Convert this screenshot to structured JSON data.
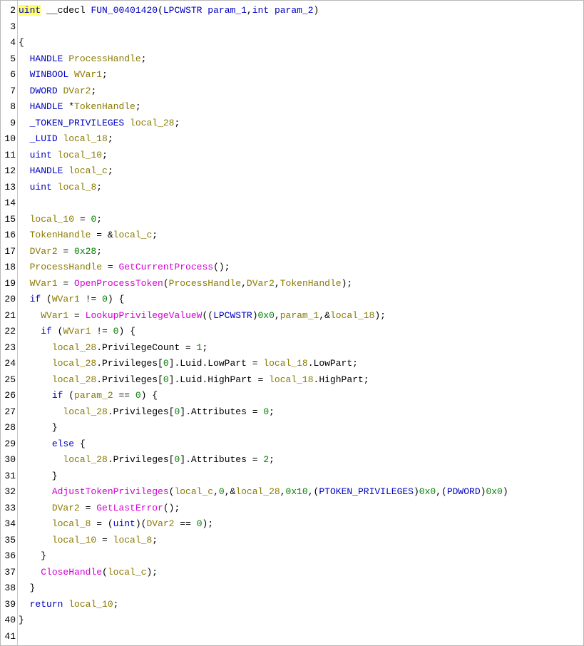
{
  "editor": {
    "colors": {
      "keyword": "#0000c0",
      "type": "#0000c0",
      "variable": "#8a7a00",
      "call": "#d400d4",
      "number": "#008000",
      "plain": "#000000",
      "highlight": "#ffff66"
    },
    "lines": [
      {
        "n": "2",
        "tokens": [
          [
            "uint",
            "ty hl"
          ],
          [
            " __cdecl ",
            ""
          ],
          [
            "FUN_00401420",
            "fn"
          ],
          [
            "(",
            ""
          ],
          [
            "LPCWSTR",
            "ty"
          ],
          [
            " ",
            ""
          ],
          [
            "param_1",
            "fn"
          ],
          [
            ",",
            ""
          ],
          [
            "int",
            "ty"
          ],
          [
            " ",
            ""
          ],
          [
            "param_2",
            "fn"
          ],
          [
            ")",
            ""
          ]
        ]
      },
      {
        "n": "3",
        "tokens": []
      },
      {
        "n": "4",
        "tokens": [
          [
            "{",
            ""
          ]
        ]
      },
      {
        "n": "5",
        "tokens": [
          [
            "  ",
            ""
          ],
          [
            "HANDLE",
            "ty"
          ],
          [
            " ",
            ""
          ],
          [
            "ProcessHandle",
            "va"
          ],
          [
            ";",
            ""
          ]
        ]
      },
      {
        "n": "6",
        "tokens": [
          [
            "  ",
            ""
          ],
          [
            "WINBOOL",
            "ty"
          ],
          [
            " ",
            ""
          ],
          [
            "WVar1",
            "va"
          ],
          [
            ";",
            ""
          ]
        ]
      },
      {
        "n": "7",
        "tokens": [
          [
            "  ",
            ""
          ],
          [
            "DWORD",
            "ty"
          ],
          [
            " ",
            ""
          ],
          [
            "DVar2",
            "va"
          ],
          [
            ";",
            ""
          ]
        ]
      },
      {
        "n": "8",
        "tokens": [
          [
            "  ",
            ""
          ],
          [
            "HANDLE",
            "ty"
          ],
          [
            " *",
            ""
          ],
          [
            "TokenHandle",
            "va"
          ],
          [
            ";",
            ""
          ]
        ]
      },
      {
        "n": "9",
        "tokens": [
          [
            "  ",
            ""
          ],
          [
            "_TOKEN_PRIVILEGES",
            "ty"
          ],
          [
            " ",
            ""
          ],
          [
            "local_28",
            "va"
          ],
          [
            ";",
            ""
          ]
        ]
      },
      {
        "n": "10",
        "tokens": [
          [
            "  ",
            ""
          ],
          [
            "_LUID",
            "ty"
          ],
          [
            " ",
            ""
          ],
          [
            "local_18",
            "va"
          ],
          [
            ";",
            ""
          ]
        ]
      },
      {
        "n": "11",
        "tokens": [
          [
            "  ",
            ""
          ],
          [
            "uint",
            "ty"
          ],
          [
            " ",
            ""
          ],
          [
            "local_10",
            "va"
          ],
          [
            ";",
            ""
          ]
        ]
      },
      {
        "n": "12",
        "tokens": [
          [
            "  ",
            ""
          ],
          [
            "HANDLE",
            "ty"
          ],
          [
            " ",
            ""
          ],
          [
            "local_c",
            "va"
          ],
          [
            ";",
            ""
          ]
        ]
      },
      {
        "n": "13",
        "tokens": [
          [
            "  ",
            ""
          ],
          [
            "uint",
            "ty"
          ],
          [
            " ",
            ""
          ],
          [
            "local_8",
            "va"
          ],
          [
            ";",
            ""
          ]
        ]
      },
      {
        "n": "14",
        "tokens": []
      },
      {
        "n": "15",
        "tokens": [
          [
            "  ",
            ""
          ],
          [
            "local_10",
            "va"
          ],
          [
            " = ",
            ""
          ],
          [
            "0",
            "nu"
          ],
          [
            ";",
            ""
          ]
        ]
      },
      {
        "n": "16",
        "tokens": [
          [
            "  ",
            ""
          ],
          [
            "TokenHandle",
            "va"
          ],
          [
            " = &",
            ""
          ],
          [
            "local_c",
            "va"
          ],
          [
            ";",
            ""
          ]
        ]
      },
      {
        "n": "17",
        "tokens": [
          [
            "  ",
            ""
          ],
          [
            "DVar2",
            "va"
          ],
          [
            " = ",
            ""
          ],
          [
            "0x28",
            "nu"
          ],
          [
            ";",
            ""
          ]
        ]
      },
      {
        "n": "18",
        "tokens": [
          [
            "  ",
            ""
          ],
          [
            "ProcessHandle",
            "va"
          ],
          [
            " = ",
            ""
          ],
          [
            "GetCurrentProcess",
            "cl"
          ],
          [
            "();",
            ""
          ]
        ]
      },
      {
        "n": "19",
        "tokens": [
          [
            "  ",
            ""
          ],
          [
            "WVar1",
            "va"
          ],
          [
            " = ",
            ""
          ],
          [
            "OpenProcessToken",
            "cl"
          ],
          [
            "(",
            ""
          ],
          [
            "ProcessHandle",
            "va"
          ],
          [
            ",",
            ""
          ],
          [
            "DVar2",
            "va"
          ],
          [
            ",",
            ""
          ],
          [
            "TokenHandle",
            "va"
          ],
          [
            ");",
            ""
          ]
        ]
      },
      {
        "n": "20",
        "tokens": [
          [
            "  ",
            ""
          ],
          [
            "if",
            "kw"
          ],
          [
            " (",
            ""
          ],
          [
            "WVar1",
            "va"
          ],
          [
            " != ",
            ""
          ],
          [
            "0",
            "nu"
          ],
          [
            ") {",
            ""
          ]
        ]
      },
      {
        "n": "21",
        "tokens": [
          [
            "    ",
            ""
          ],
          [
            "WVar1",
            "va"
          ],
          [
            " = ",
            ""
          ],
          [
            "LookupPrivilegeValueW",
            "cl"
          ],
          [
            "((",
            ""
          ],
          [
            "LPCWSTR",
            "ty"
          ],
          [
            ")",
            ""
          ],
          [
            "0x0",
            "nu"
          ],
          [
            ",",
            ""
          ],
          [
            "param_1",
            "va"
          ],
          [
            ",&",
            ""
          ],
          [
            "local_18",
            "va"
          ],
          [
            ");",
            ""
          ]
        ]
      },
      {
        "n": "22",
        "tokens": [
          [
            "    ",
            ""
          ],
          [
            "if",
            "kw"
          ],
          [
            " (",
            ""
          ],
          [
            "WVar1",
            "va"
          ],
          [
            " != ",
            ""
          ],
          [
            "0",
            "nu"
          ],
          [
            ") {",
            ""
          ]
        ]
      },
      {
        "n": "23",
        "tokens": [
          [
            "      ",
            ""
          ],
          [
            "local_28",
            "va"
          ],
          [
            ".PrivilegeCount = ",
            ""
          ],
          [
            "1",
            "nu"
          ],
          [
            ";",
            ""
          ]
        ]
      },
      {
        "n": "24",
        "tokens": [
          [
            "      ",
            ""
          ],
          [
            "local_28",
            "va"
          ],
          [
            ".Privileges[",
            ""
          ],
          [
            "0",
            "nu"
          ],
          [
            "].Luid.LowPart = ",
            ""
          ],
          [
            "local_18",
            "va"
          ],
          [
            ".LowPart;",
            ""
          ]
        ]
      },
      {
        "n": "25",
        "tokens": [
          [
            "      ",
            ""
          ],
          [
            "local_28",
            "va"
          ],
          [
            ".Privileges[",
            ""
          ],
          [
            "0",
            "nu"
          ],
          [
            "].Luid.HighPart = ",
            ""
          ],
          [
            "local_18",
            "va"
          ],
          [
            ".HighPart;",
            ""
          ]
        ]
      },
      {
        "n": "26",
        "tokens": [
          [
            "      ",
            ""
          ],
          [
            "if",
            "kw"
          ],
          [
            " (",
            ""
          ],
          [
            "param_2",
            "va"
          ],
          [
            " == ",
            ""
          ],
          [
            "0",
            "nu"
          ],
          [
            ") {",
            ""
          ]
        ]
      },
      {
        "n": "27",
        "tokens": [
          [
            "        ",
            ""
          ],
          [
            "local_28",
            "va"
          ],
          [
            ".Privileges[",
            ""
          ],
          [
            "0",
            "nu"
          ],
          [
            "].Attributes = ",
            ""
          ],
          [
            "0",
            "nu"
          ],
          [
            ";",
            ""
          ]
        ]
      },
      {
        "n": "28",
        "tokens": [
          [
            "      }",
            ""
          ]
        ]
      },
      {
        "n": "29",
        "tokens": [
          [
            "      ",
            ""
          ],
          [
            "else",
            "kw"
          ],
          [
            " {",
            ""
          ]
        ]
      },
      {
        "n": "30",
        "tokens": [
          [
            "        ",
            ""
          ],
          [
            "local_28",
            "va"
          ],
          [
            ".Privileges[",
            ""
          ],
          [
            "0",
            "nu"
          ],
          [
            "].Attributes = ",
            ""
          ],
          [
            "2",
            "nu"
          ],
          [
            ";",
            ""
          ]
        ]
      },
      {
        "n": "31",
        "tokens": [
          [
            "      }",
            ""
          ]
        ]
      },
      {
        "n": "32",
        "tokens": [
          [
            "      ",
            ""
          ],
          [
            "AdjustTokenPrivileges",
            "cl"
          ],
          [
            "(",
            ""
          ],
          [
            "local_c",
            "va"
          ],
          [
            ",",
            ""
          ],
          [
            "0",
            "nu"
          ],
          [
            ",&",
            ""
          ],
          [
            "local_28",
            "va"
          ],
          [
            ",",
            ""
          ],
          [
            "0x10",
            "nu"
          ],
          [
            ",(",
            ""
          ],
          [
            "PTOKEN_PRIVILEGES",
            "ty"
          ],
          [
            ")",
            ""
          ],
          [
            "0x0",
            "nu"
          ],
          [
            ",(",
            ""
          ],
          [
            "PDWORD",
            "ty"
          ],
          [
            ")",
            ""
          ],
          [
            "0x0",
            "nu"
          ],
          [
            ")",
            ""
          ]
        ]
      },
      {
        "n": "33",
        "tokens": [
          [
            "      ",
            ""
          ],
          [
            "DVar2",
            "va"
          ],
          [
            " = ",
            ""
          ],
          [
            "GetLastError",
            "cl"
          ],
          [
            "();",
            ""
          ]
        ]
      },
      {
        "n": "34",
        "tokens": [
          [
            "      ",
            ""
          ],
          [
            "local_8",
            "va"
          ],
          [
            " = (",
            ""
          ],
          [
            "uint",
            "ty"
          ],
          [
            ")(",
            ""
          ],
          [
            "DVar2",
            "va"
          ],
          [
            " == ",
            ""
          ],
          [
            "0",
            "nu"
          ],
          [
            ");",
            ""
          ]
        ]
      },
      {
        "n": "35",
        "tokens": [
          [
            "      ",
            ""
          ],
          [
            "local_10",
            "va"
          ],
          [
            " = ",
            ""
          ],
          [
            "local_8",
            "va"
          ],
          [
            ";",
            ""
          ]
        ]
      },
      {
        "n": "36",
        "tokens": [
          [
            "    }",
            ""
          ]
        ]
      },
      {
        "n": "37",
        "tokens": [
          [
            "    ",
            ""
          ],
          [
            "CloseHandle",
            "cl"
          ],
          [
            "(",
            ""
          ],
          [
            "local_c",
            "va"
          ],
          [
            ");",
            ""
          ]
        ]
      },
      {
        "n": "38",
        "tokens": [
          [
            "  }",
            ""
          ]
        ]
      },
      {
        "n": "39",
        "tokens": [
          [
            "  ",
            ""
          ],
          [
            "return",
            "kw"
          ],
          [
            " ",
            ""
          ],
          [
            "local_10",
            "va"
          ],
          [
            ";",
            ""
          ]
        ]
      },
      {
        "n": "40",
        "tokens": [
          [
            "}",
            ""
          ]
        ]
      },
      {
        "n": "41",
        "tokens": []
      }
    ]
  }
}
